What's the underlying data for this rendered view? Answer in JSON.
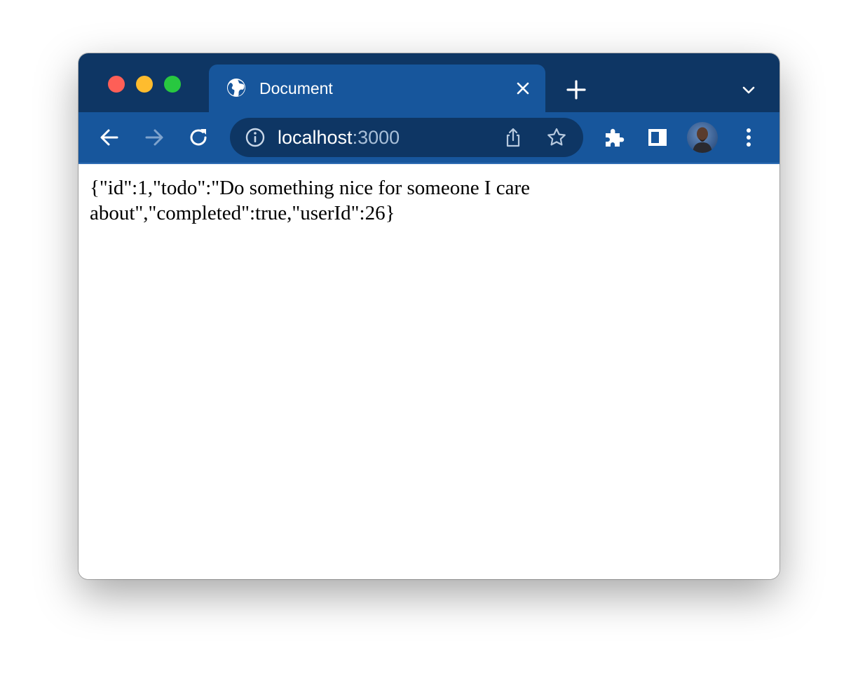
{
  "window": {
    "traffic_lights": [
      "close",
      "minimize",
      "maximize"
    ]
  },
  "tab": {
    "title": "Document",
    "icon": "globe-icon"
  },
  "toolbar": {
    "icons": [
      "back-arrow-icon",
      "forward-arrow-icon",
      "reload-icon",
      "info-icon",
      "share-icon",
      "star-icon",
      "extensions-icon",
      "side-panel-icon",
      "avatar",
      "menu-icon"
    ]
  },
  "address_bar": {
    "host": "localhost",
    "port": ":3000"
  },
  "page": {
    "body_text": "{\"id\":1,\"todo\":\"Do something nice for someone I care about\",\"completed\":true,\"userId\":26}"
  },
  "colors": {
    "titlebar": "#0e3664",
    "tab_and_toolbar": "#17569c",
    "omnibox": "#0e3664"
  }
}
